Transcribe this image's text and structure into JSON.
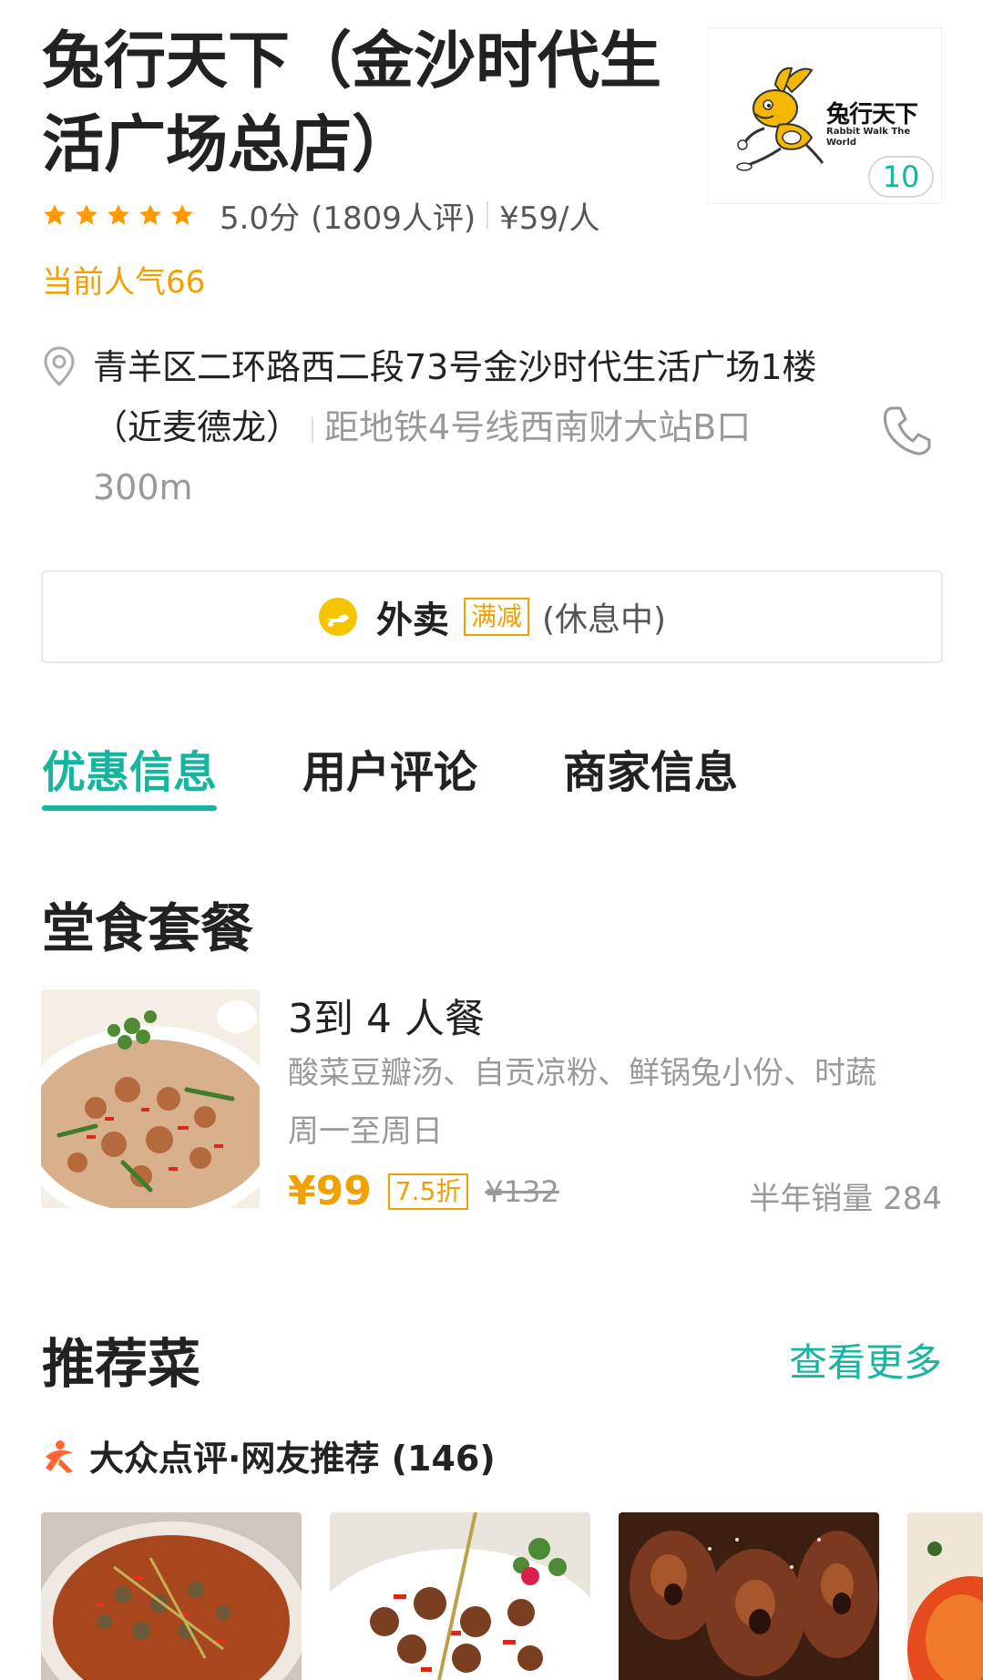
{
  "shop": {
    "name": "兔行天下（金沙时代生活广场总店）",
    "logo": {
      "cn": "兔行天下",
      "en": "Rabbit Walk The World"
    },
    "photo_count": "10",
    "rating": 5.0,
    "rating_text": "5.0分",
    "review_count_text": "(1809人评)",
    "price_per_person": "¥59/人",
    "popularity": "当前人气66",
    "address": "青羊区二环路西二段73号金沙时代生活广场1楼（近麦德龙）",
    "distance": "距地铁4号线西南财大站B口300m"
  },
  "takeaway": {
    "label": "外卖",
    "badge": "满减",
    "status": "(休息中)"
  },
  "tabs": [
    {
      "label": "优惠信息",
      "active": true
    },
    {
      "label": "用户评论",
      "active": false
    },
    {
      "label": "商家信息",
      "active": false
    }
  ],
  "set_meal": {
    "section_title": "堂食套餐",
    "name": "3到 4 人餐",
    "description": "酸菜豆瓣汤、自贡凉粉、鲜锅兔小份、时蔬",
    "days": "周一至周日",
    "price": "¥99",
    "discount": "7.5折",
    "original_price": "¥132",
    "sales": "半年销量 284"
  },
  "recommended": {
    "section_title": "推荐菜",
    "see_more": "查看更多",
    "source_label": "大众点评·网友推荐 (146)"
  },
  "colors": {
    "accent": "#15b59f",
    "orange": "#f0a000",
    "star": "#ff9900"
  },
  "icons": [
    "star-icon",
    "location-pin-icon",
    "phone-icon",
    "takeaway-icon",
    "dianping-icon",
    "rabbit-logo"
  ]
}
